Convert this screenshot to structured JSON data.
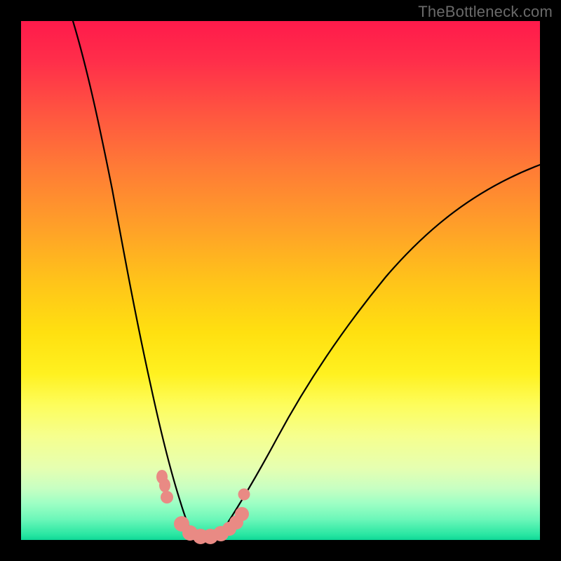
{
  "watermark": "TheBottleneck.com",
  "chart_data": {
    "type": "line",
    "title": "",
    "xlabel": "",
    "ylabel": "",
    "xlim": [
      0,
      100
    ],
    "ylim": [
      0,
      100
    ],
    "background_gradient": {
      "top": "#ff1a4b",
      "mid": "#ffe010",
      "bottom": "#0fd796"
    },
    "series": [
      {
        "name": "left-curve",
        "x": [
          10,
          12,
          14,
          16,
          18,
          20,
          22,
          24,
          25.5,
          27,
          28.5,
          30,
          31.5,
          33
        ],
        "y": [
          100,
          88,
          76,
          65,
          54,
          44,
          34,
          25,
          19,
          13,
          8.5,
          5,
          2,
          0.5
        ]
      },
      {
        "name": "right-curve",
        "x": [
          38,
          40,
          43,
          47,
          52,
          58,
          65,
          73,
          82,
          92,
          100
        ],
        "y": [
          0.5,
          3,
          8,
          16,
          25,
          34,
          43,
          52,
          60,
          67,
          72
        ]
      }
    ],
    "markers": {
      "name": "highlight-dots",
      "color": "#e98a84",
      "points": [
        {
          "x": 27.2,
          "y": 12.2,
          "r": 1.2
        },
        {
          "x": 27.7,
          "y": 10.8,
          "r": 1.3
        },
        {
          "x": 28.0,
          "y": 8.2,
          "r": 1.2
        },
        {
          "x": 31.0,
          "y": 3.0,
          "r": 1.5
        },
        {
          "x": 32.5,
          "y": 1.2,
          "r": 1.5
        },
        {
          "x": 34.5,
          "y": 0.6,
          "r": 1.5
        },
        {
          "x": 36.5,
          "y": 0.8,
          "r": 1.5
        },
        {
          "x": 38.5,
          "y": 1.2,
          "r": 1.5
        },
        {
          "x": 40.0,
          "y": 2.0,
          "r": 1.4
        },
        {
          "x": 41.5,
          "y": 3.2,
          "r": 1.4
        },
        {
          "x": 42.6,
          "y": 5.0,
          "r": 1.4
        },
        {
          "x": 43.0,
          "y": 8.8,
          "r": 1.15
        }
      ]
    }
  }
}
